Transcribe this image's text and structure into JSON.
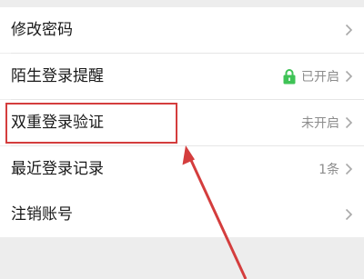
{
  "settings": {
    "change_password": {
      "label": "修改密码"
    },
    "stranger_login_alert": {
      "label": "陌生登录提醒",
      "value": "已开启"
    },
    "two_factor": {
      "label": "双重登录验证",
      "value": "未开启"
    },
    "recent_logins": {
      "label": "最近登录记录",
      "value": "1条"
    },
    "cancel_account": {
      "label": "注销账号"
    }
  },
  "colors": {
    "annotation": "#d43d3d",
    "lock": "#3fc356",
    "background": "#ededed"
  }
}
